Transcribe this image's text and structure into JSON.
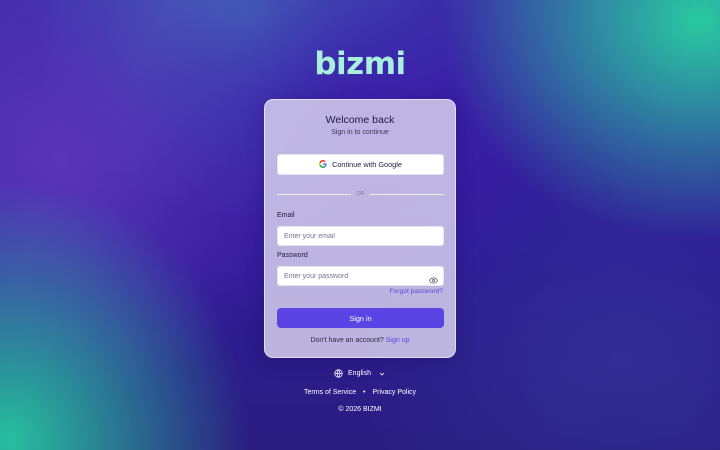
{
  "brand": {
    "logo_text": "bizmi",
    "logo_color": "#a9efdd"
  },
  "card": {
    "title": "Welcome back",
    "subtitle": "Sign in to continue",
    "google_button_label": "Continue with Google",
    "divider_text": "OR",
    "email": {
      "label": "Email",
      "placeholder": "Enter your email",
      "value": ""
    },
    "password": {
      "label": "Password",
      "placeholder": "Enter your password",
      "value": ""
    },
    "forgot_password_label": "Forgot password?",
    "sign_in_label": "Sign in",
    "signup_prompt": "Don't have an account?",
    "signup_link": "Sign up"
  },
  "language": {
    "selected": "English"
  },
  "footer": {
    "terms": "Terms of Service",
    "separator": "•",
    "privacy": "Privacy Policy",
    "copyright": "© 2026 BIZMI"
  },
  "icons": {
    "google": "google-icon",
    "eye": "eye-icon",
    "globe": "globe-icon",
    "chevron": "chevron-down-icon"
  },
  "colors": {
    "accent": "#5a45e4",
    "link": "#5b45e0",
    "card_bg": "#dcd7f0",
    "text": "#1e1b3a"
  }
}
